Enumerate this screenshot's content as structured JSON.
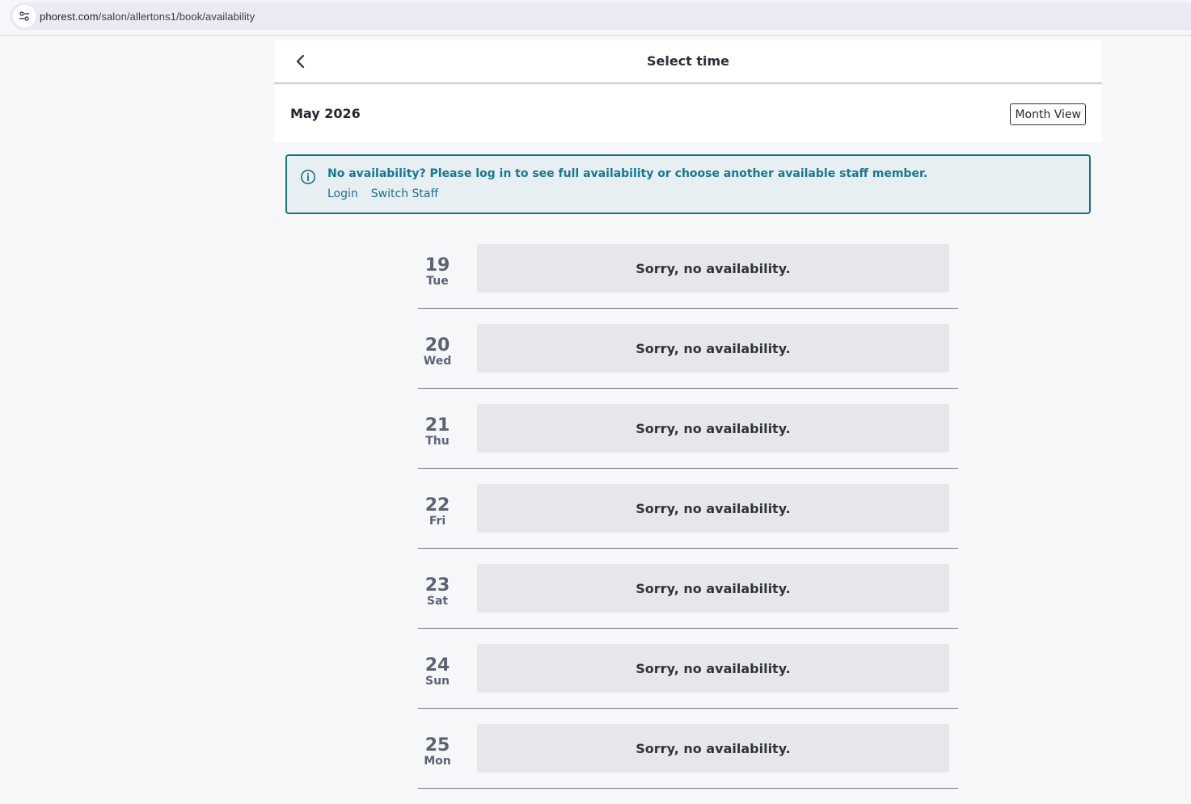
{
  "browser": {
    "url_host": "phorest.com",
    "url_path": "/salon/allertons1/book/availability"
  },
  "header": {
    "title": "Select time"
  },
  "calendar": {
    "month": "May 2026",
    "view_button": "Month View"
  },
  "alert": {
    "message": "No availability? Please log in to see full availability or choose another available staff member.",
    "login_link": "Login",
    "switch_staff_link": "Switch Staff"
  },
  "days": [
    {
      "date": "19",
      "weekday": "Tue",
      "status": "Sorry, no availability."
    },
    {
      "date": "20",
      "weekday": "Wed",
      "status": "Sorry, no availability."
    },
    {
      "date": "21",
      "weekday": "Thu",
      "status": "Sorry, no availability."
    },
    {
      "date": "22",
      "weekday": "Fri",
      "status": "Sorry, no availability."
    },
    {
      "date": "23",
      "weekday": "Sat",
      "status": "Sorry, no availability."
    },
    {
      "date": "24",
      "weekday": "Sun",
      "status": "Sorry, no availability."
    },
    {
      "date": "25",
      "weekday": "Mon",
      "status": "Sorry, no availability."
    }
  ],
  "colors": {
    "alert_accent": "#1d6f86",
    "alert_background": "#e8eff2",
    "slot_background": "#e6e7eb"
  },
  "icons": {
    "site_settings": "tune-icon",
    "back": "chevron-left-icon",
    "alert": "info-icon"
  }
}
